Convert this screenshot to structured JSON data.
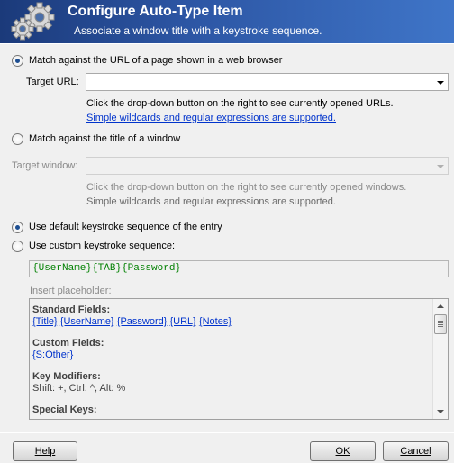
{
  "dialog": {
    "title": "Configure Auto-Type Item",
    "subtitle": "Associate a window title with a keystroke sequence."
  },
  "url_section": {
    "radio_label": "Match against the URL of a page shown in a web browser",
    "target_label": "Target URL:",
    "target_value": "",
    "hint": "Click the drop-down button on the right to see currently opened URLs.",
    "link": "Simple wildcards and regular expressions are supported."
  },
  "window_section": {
    "radio_label": "Match against the title of a window",
    "target_label": "Target window:",
    "target_value": "",
    "hint": "Click the drop-down button on the right to see currently opened windows.",
    "support": "Simple wildcards and regular expressions are supported."
  },
  "sequence": {
    "default_label": "Use default keystroke sequence of the entry",
    "custom_label": "Use custom keystroke sequence:",
    "value": "{UserName}{TAB}{Password}",
    "insert_label": "Insert placeholder:"
  },
  "placeholders": {
    "standard_head": "Standard Fields:",
    "standard": [
      "{Title}",
      "{UserName}",
      "{Password}",
      "{URL}",
      "{Notes}"
    ],
    "custom_head": "Custom Fields:",
    "custom": [
      "{S:Other}"
    ],
    "modifiers_head": "Key Modifiers:",
    "modifiers_text": "Shift: +, Ctrl: ^, Alt: %",
    "special_head": "Special Keys:"
  },
  "buttons": {
    "help": "Help",
    "ok": "OK",
    "cancel": "Cancel"
  },
  "state": {
    "match_mode": "url",
    "use_default_sequence": true
  },
  "colors": {
    "banner_start": "#1b3a7a",
    "banner_end": "#3f75c8",
    "link": "#0033cc",
    "sequence_text": "#008000"
  }
}
